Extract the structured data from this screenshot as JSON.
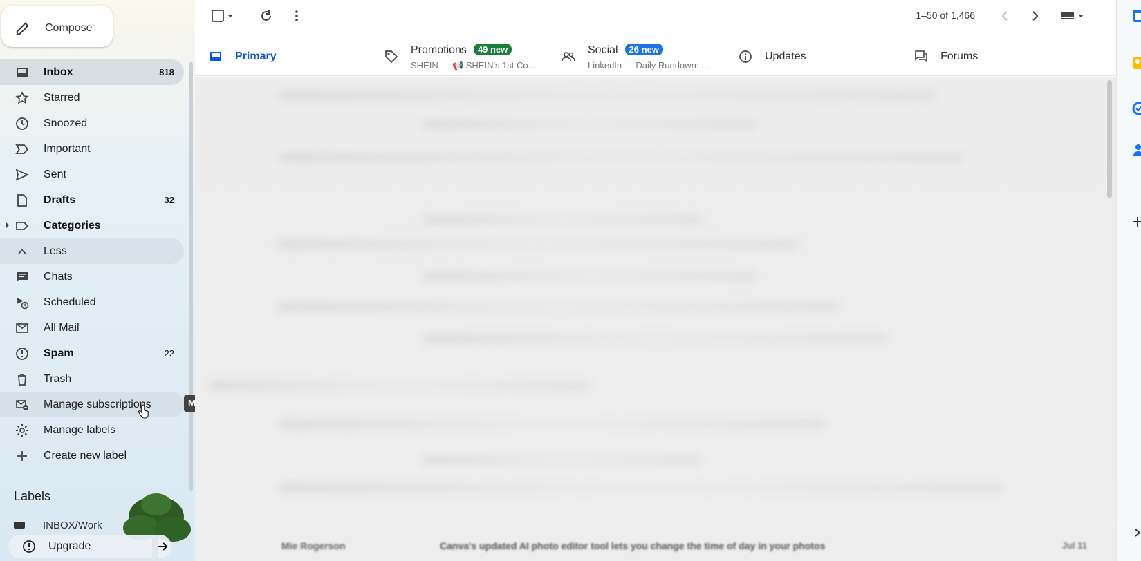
{
  "compose": {
    "label": "Compose"
  },
  "sidebar": {
    "items": [
      {
        "key": "inbox",
        "label": "Inbox",
        "count": "818",
        "icon": "inbox-icon"
      },
      {
        "key": "starred",
        "label": "Starred",
        "count": "",
        "icon": "star-icon"
      },
      {
        "key": "snoozed",
        "label": "Snoozed",
        "count": "",
        "icon": "clock-icon"
      },
      {
        "key": "important",
        "label": "Important",
        "count": "",
        "icon": "important-icon"
      },
      {
        "key": "sent",
        "label": "Sent",
        "count": "",
        "icon": "send-icon"
      },
      {
        "key": "drafts",
        "label": "Drafts",
        "count": "32",
        "icon": "draft-icon"
      },
      {
        "key": "categories",
        "label": "Categories",
        "count": "",
        "icon": "label-icon"
      },
      {
        "key": "less",
        "label": "Less",
        "count": "",
        "icon": "chevron-up-icon"
      },
      {
        "key": "chats",
        "label": "Chats",
        "count": "",
        "icon": "chat-icon"
      },
      {
        "key": "scheduled",
        "label": "Scheduled",
        "count": "",
        "icon": "scheduled-send-icon"
      },
      {
        "key": "all-mail",
        "label": "All Mail",
        "count": "",
        "icon": "all-mail-icon"
      },
      {
        "key": "spam",
        "label": "Spam",
        "count": "22",
        "icon": "spam-icon"
      },
      {
        "key": "trash",
        "label": "Trash",
        "count": "",
        "icon": "trash-icon"
      },
      {
        "key": "manage-subscriptions",
        "label": "Manage subscriptions",
        "count": "",
        "icon": "unsubscribe-icon"
      },
      {
        "key": "manage-labels",
        "label": "Manage labels",
        "count": "",
        "icon": "gear-icon"
      },
      {
        "key": "create-new-label",
        "label": "Create new label",
        "count": "",
        "icon": "plus-icon"
      }
    ],
    "labels_heading": "Labels",
    "label_peek": "INBOX/Work",
    "tooltip_char": "M",
    "upgrade_label": "Upgrade"
  },
  "toolbar": {
    "pager": "1–50 of 1,466"
  },
  "tabs": [
    {
      "key": "primary",
      "label": "Primary",
      "badge": "",
      "snippet": "",
      "icon": "inbox-tab-icon"
    },
    {
      "key": "promotions",
      "label": "Promotions",
      "badge": "49 new",
      "snippet": "SHEIN — 📢 SHEIN's 1st Co...",
      "icon": "tag-icon"
    },
    {
      "key": "social",
      "label": "Social",
      "badge": "26 new",
      "snippet": "LinkedIn — Daily Rundown: ...",
      "icon": "people-icon"
    },
    {
      "key": "updates",
      "label": "Updates",
      "badge": "",
      "snippet": "",
      "icon": "info-icon"
    },
    {
      "key": "forums",
      "label": "Forums",
      "badge": "",
      "snippet": "",
      "icon": "forum-icon"
    }
  ],
  "visible_message": {
    "sender": "Mie Rogerson",
    "subject": "Canva's updated AI photo editor tool lets you change the time of day in your photos",
    "date": "Jul 11"
  },
  "colors": {
    "accent": "#0b57d0",
    "promotions_badge": "#188038",
    "social_badge": "#1a73e8"
  }
}
